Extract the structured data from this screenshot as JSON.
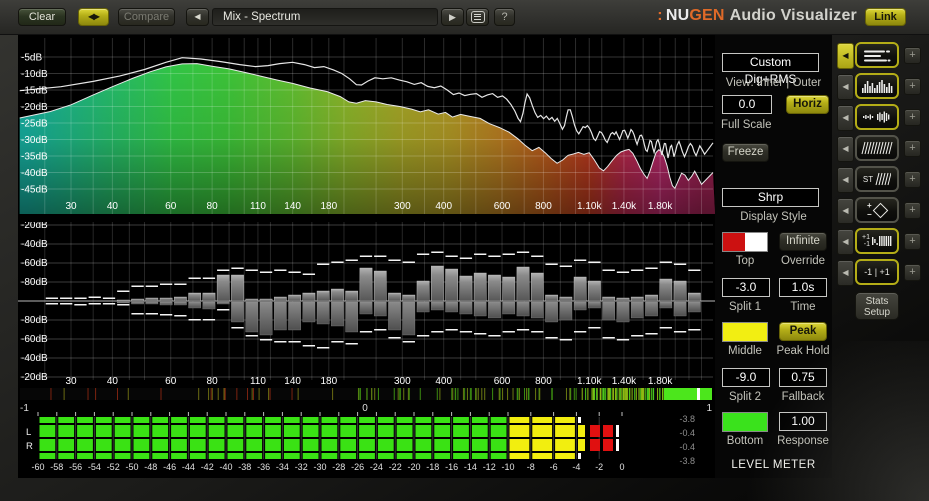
{
  "logo": {
    "dots": ":",
    "nu": "NU",
    "gen": "GEN",
    "rest": "Audio Visualizer",
    "accent": "#e06a28"
  },
  "toolbar": {
    "clear": "Clear",
    "ab_icon": "◀▶",
    "compare": "Compare",
    "prev_icon": "◀",
    "preset": "Mix - Spectrum",
    "next_icon": "▶",
    "help": "?",
    "link": "Link"
  },
  "spectrum": {
    "db_labels": [
      "-5dB",
      "-10dB",
      "-15dB",
      "-20dB",
      "-25dB",
      "-30dB",
      "-35dB",
      "-40dB",
      "-45dB"
    ],
    "db_values": [
      -5,
      -10,
      -15,
      -20,
      -25,
      -30,
      -35,
      -40,
      -45
    ],
    "freq_labels": [
      [
        30,
        "30"
      ],
      [
        40,
        "40"
      ],
      [
        60,
        "60"
      ],
      [
        80,
        "80"
      ],
      [
        110,
        "110"
      ],
      [
        140,
        "140"
      ],
      [
        180,
        "180"
      ],
      [
        300,
        "300"
      ],
      [
        400,
        "400"
      ],
      [
        600,
        "600"
      ],
      [
        800,
        "800"
      ],
      [
        1100,
        "1.10k"
      ],
      [
        1400,
        "1.40k"
      ],
      [
        1800,
        "1.80k"
      ]
    ],
    "grid_freqs": [
      25,
      30,
      35,
      40,
      45,
      50,
      60,
      70,
      80,
      90,
      100,
      110,
      120,
      140,
      160,
      180,
      200,
      250,
      300,
      350,
      400,
      450,
      500,
      600,
      700,
      800,
      900,
      1000,
      1100,
      1200,
      1400,
      1600,
      1800,
      2000,
      2200,
      2400
    ],
    "gradient_stops": [
      [
        22,
        "#17b2a2"
      ],
      [
        40,
        "#27c06b"
      ],
      [
        60,
        "#33cb49"
      ],
      [
        90,
        "#3fc93a"
      ],
      [
        140,
        "#63c231"
      ],
      [
        200,
        "#8cb92b"
      ],
      [
        300,
        "#a9a827"
      ],
      [
        420,
        "#b49b25"
      ],
      [
        600,
        "#bd7f22"
      ],
      [
        800,
        "#c1611d"
      ],
      [
        1100,
        "#c23b20"
      ],
      [
        1400,
        "#c02a50"
      ],
      [
        1800,
        "#bf2a6e"
      ],
      [
        2400,
        "#a82458"
      ]
    ],
    "fill_points": [
      [
        21,
        -23.5
      ],
      [
        26,
        -21.5
      ],
      [
        30,
        -19.5
      ],
      [
        35,
        -16.5
      ],
      [
        40,
        -14
      ],
      [
        46,
        -11.5
      ],
      [
        52,
        -9.5
      ],
      [
        58,
        -8
      ],
      [
        65,
        -7.1
      ],
      [
        72,
        -7
      ],
      [
        80,
        -7.8
      ],
      [
        90,
        -8.6
      ],
      [
        100,
        -9.6
      ],
      [
        112,
        -10.8
      ],
      [
        126,
        -12
      ],
      [
        140,
        -13
      ],
      [
        158,
        -14.4
      ],
      [
        178,
        -15.5
      ],
      [
        195,
        -17
      ],
      [
        207,
        -18.6
      ],
      [
        218,
        -19
      ],
      [
        232,
        -18.2
      ],
      [
        250,
        -18.6
      ],
      [
        270,
        -19.4
      ],
      [
        295,
        -20
      ],
      [
        320,
        -20.8
      ],
      [
        340,
        -21.6
      ],
      [
        360,
        -21
      ],
      [
        385,
        -22.3
      ],
      [
        405,
        -21.8
      ],
      [
        425,
        -23.2
      ],
      [
        450,
        -22.4
      ],
      [
        480,
        -23
      ],
      [
        515,
        -23.6
      ],
      [
        550,
        -25.2
      ],
      [
        590,
        -26.4
      ],
      [
        630,
        -27.8
      ],
      [
        670,
        -29.8
      ],
      [
        705,
        -31.8
      ],
      [
        740,
        -33.4
      ],
      [
        775,
        -32.4
      ],
      [
        810,
        -34
      ],
      [
        845,
        -35.8
      ],
      [
        880,
        -37.2
      ],
      [
        915,
        -36.2
      ],
      [
        950,
        -34.8
      ],
      [
        985,
        -34.4
      ],
      [
        1020,
        -33.9
      ],
      [
        1060,
        -34.5
      ],
      [
        1100,
        -34
      ],
      [
        1140,
        -36.2
      ],
      [
        1180,
        -38.6
      ],
      [
        1215,
        -39.5
      ],
      [
        1250,
        -38.2
      ],
      [
        1290,
        -36.4
      ],
      [
        1330,
        -34.8
      ],
      [
        1370,
        -33.8
      ],
      [
        1410,
        -33.3
      ],
      [
        1450,
        -33
      ],
      [
        1490,
        -34.2
      ],
      [
        1530,
        -36.4
      ],
      [
        1570,
        -38.8
      ],
      [
        1610,
        -40.6
      ],
      [
        1645,
        -41.8
      ],
      [
        1680,
        -39.4
      ],
      [
        1715,
        -36.6
      ],
      [
        1750,
        -34
      ],
      [
        1785,
        -33.1
      ],
      [
        1820,
        -33.8
      ],
      [
        1855,
        -35.4
      ],
      [
        1890,
        -38
      ],
      [
        1925,
        -41.4
      ],
      [
        1960,
        -44
      ],
      [
        1995,
        -44.8
      ],
      [
        2040,
        -42.6
      ],
      [
        2090,
        -40.2
      ],
      [
        2140,
        -40.8
      ],
      [
        2190,
        -42.4
      ],
      [
        2240,
        -41.2
      ],
      [
        2290,
        -39.6
      ],
      [
        2340,
        -41.4
      ],
      [
        2400,
        -43.6
      ],
      [
        2600,
        -40
      ]
    ],
    "outer_points": [
      [
        21,
        -15.2
      ],
      [
        28,
        -14
      ],
      [
        35,
        -12.4
      ],
      [
        42,
        -10.8
      ],
      [
        50,
        -8.8
      ],
      [
        58,
        -6.6
      ],
      [
        65,
        -5.2
      ],
      [
        74,
        -5.6
      ],
      [
        85,
        -6.4
      ],
      [
        97,
        -7.3
      ],
      [
        108,
        -7.9
      ],
      [
        118,
        -7.6
      ],
      [
        128,
        -7
      ],
      [
        140,
        -6.6
      ],
      [
        152,
        -7.3
      ],
      [
        163,
        -8.2
      ],
      [
        174,
        -7.9
      ],
      [
        186,
        -8.9
      ],
      [
        197,
        -10
      ],
      [
        208,
        -11.6
      ],
      [
        218,
        -13.4
      ],
      [
        226,
        -13.5
      ],
      [
        236,
        -12.3
      ],
      [
        248,
        -11.3
      ],
      [
        262,
        -11.6
      ],
      [
        278,
        -11.3
      ],
      [
        294,
        -12
      ],
      [
        310,
        -12.5
      ],
      [
        326,
        -13.3
      ],
      [
        342,
        -12.8
      ],
      [
        358,
        -13.9
      ],
      [
        375,
        -14.3
      ],
      [
        392,
        -13.8
      ],
      [
        410,
        -15
      ],
      [
        428,
        -16.4
      ],
      [
        445,
        -15.9
      ],
      [
        463,
        -16.7
      ],
      [
        482,
        -16.3
      ],
      [
        502,
        -16.1
      ],
      [
        522,
        -17.2
      ],
      [
        542,
        -16.5
      ],
      [
        562,
        -16.1
      ],
      [
        582,
        -17.2
      ],
      [
        602,
        -16.8
      ],
      [
        620,
        -17.8
      ],
      [
        638,
        -19.4
      ],
      [
        656,
        -21.4
      ],
      [
        671,
        -23.6
      ],
      [
        682,
        -24.6
      ],
      [
        694,
        -22
      ],
      [
        704,
        -18.8
      ],
      [
        714,
        -16.2
      ],
      [
        727,
        -17.4
      ],
      [
        741,
        -19.8
      ],
      [
        755,
        -21.9
      ],
      [
        769,
        -23.3
      ],
      [
        785,
        -22.7
      ],
      [
        801,
        -23.7
      ],
      [
        817,
        -22.9
      ],
      [
        833,
        -24
      ],
      [
        849,
        -23.3
      ],
      [
        865,
        -24.5
      ],
      [
        881,
        -23.6
      ],
      [
        897,
        -25.2
      ],
      [
        913,
        -26.9
      ],
      [
        926,
        -25.8
      ],
      [
        938,
        -23.2
      ],
      [
        950,
        -21
      ],
      [
        964,
        -21
      ],
      [
        978,
        -23
      ],
      [
        993,
        -25.6
      ],
      [
        1008,
        -27.4
      ],
      [
        1023,
        -28.3
      ],
      [
        1038,
        -27.2
      ],
      [
        1054,
        -26.1
      ],
      [
        1070,
        -26.4
      ],
      [
        1086,
        -25.8
      ],
      [
        1102,
        -26.6
      ],
      [
        1118,
        -28
      ],
      [
        1134,
        -29.7
      ],
      [
        1150,
        -30.3
      ],
      [
        1166,
        -29
      ],
      [
        1182,
        -27.6
      ],
      [
        1198,
        -27.9
      ],
      [
        1214,
        -28.9
      ],
      [
        1230,
        -30.2
      ],
      [
        1246,
        -30.9
      ],
      [
        1262,
        -29.6
      ],
      [
        1278,
        -28.3
      ],
      [
        1294,
        -27.9
      ],
      [
        1310,
        -28.5
      ],
      [
        1326,
        -27.7
      ],
      [
        1342,
        -28.9
      ],
      [
        1358,
        -30
      ],
      [
        1374,
        -28.7
      ],
      [
        1390,
        -27.3
      ],
      [
        1406,
        -27.2
      ],
      [
        1422,
        -28.3
      ],
      [
        1438,
        -29.6
      ],
      [
        1454,
        -28.4
      ],
      [
        1470,
        -27
      ],
      [
        1486,
        -27.5
      ],
      [
        1502,
        -28.6
      ],
      [
        1518,
        -30.2
      ],
      [
        1534,
        -31.5
      ],
      [
        1550,
        -30
      ],
      [
        1566,
        -28.8
      ],
      [
        1582,
        -28.7
      ],
      [
        1598,
        -29.8
      ],
      [
        1614,
        -31.6
      ],
      [
        1630,
        -33.2
      ],
      [
        1646,
        -33.6
      ],
      [
        1662,
        -32
      ],
      [
        1678,
        -30.3
      ],
      [
        1694,
        -30.6
      ],
      [
        1710,
        -32.4
      ],
      [
        1726,
        -33.9
      ],
      [
        1742,
        -32.3
      ],
      [
        1758,
        -30.6
      ],
      [
        1774,
        -30.1
      ],
      [
        1790,
        -31.2
      ],
      [
        1806,
        -33
      ],
      [
        1822,
        -34.7
      ],
      [
        1838,
        -32.9
      ],
      [
        1854,
        -31.2
      ],
      [
        1870,
        -31.3
      ],
      [
        1886,
        -33.3
      ],
      [
        1902,
        -35.6
      ],
      [
        1918,
        -34
      ],
      [
        1934,
        -32.2
      ],
      [
        1950,
        -31.8
      ],
      [
        1966,
        -33.4
      ],
      [
        1982,
        -35.2
      ],
      [
        2002,
        -33.8
      ],
      [
        2026,
        -31.7
      ],
      [
        2052,
        -30.6
      ],
      [
        2076,
        -31.9
      ],
      [
        2102,
        -33.7
      ],
      [
        2132,
        -35.2
      ],
      [
        2162,
        -33.8
      ],
      [
        2192,
        -32.1
      ],
      [
        2222,
        -31.2
      ],
      [
        2252,
        -32
      ],
      [
        2282,
        -33.8
      ],
      [
        2312,
        -34.9
      ],
      [
        2342,
        -33.4
      ],
      [
        2372,
        -31.9
      ],
      [
        2402,
        -32.8
      ],
      [
        2452,
        -34.5
      ],
      [
        2600,
        -31
      ]
    ]
  },
  "bars_display": {
    "db_labels": [
      "-20dB",
      "-40dB",
      "-60dB",
      "-80dB"
    ],
    "fmin": 25,
    "fmax": 2400,
    "bands": 46,
    "bars": [
      [
        0,
        0,
        2,
        2
      ],
      [
        0,
        0,
        2,
        2
      ],
      [
        0,
        0,
        2,
        3
      ],
      [
        0,
        0,
        3,
        2
      ],
      [
        0,
        0,
        2,
        2
      ],
      [
        1,
        1,
        9,
        3
      ],
      [
        2,
        2,
        14,
        12
      ],
      [
        3,
        2,
        14,
        12
      ],
      [
        3,
        3,
        16,
        13
      ],
      [
        4,
        3,
        16,
        14
      ],
      [
        8,
        6,
        22,
        18
      ],
      [
        8,
        7,
        22,
        18
      ],
      [
        26,
        2,
        30,
        8
      ],
      [
        26,
        20,
        32,
        26
      ],
      [
        2,
        30,
        30,
        34
      ],
      [
        2,
        33,
        28,
        38
      ],
      [
        4,
        28,
        30,
        40
      ],
      [
        6,
        28,
        28,
        40
      ],
      [
        8,
        20,
        26,
        44
      ],
      [
        10,
        22,
        36,
        46
      ],
      [
        12,
        24,
        38,
        40
      ],
      [
        10,
        30,
        40,
        42
      ],
      [
        33,
        12,
        44,
        30
      ],
      [
        30,
        14,
        44,
        28
      ],
      [
        8,
        28,
        40,
        36
      ],
      [
        6,
        33,
        38,
        40
      ],
      [
        20,
        10,
        46,
        34
      ],
      [
        35,
        8,
        48,
        30
      ],
      [
        32,
        10,
        44,
        28
      ],
      [
        25,
        12,
        42,
        30
      ],
      [
        28,
        14,
        46,
        32
      ],
      [
        26,
        16,
        44,
        34
      ],
      [
        24,
        12,
        46,
        30
      ],
      [
        34,
        14,
        48,
        28
      ],
      [
        28,
        16,
        44,
        30
      ],
      [
        6,
        20,
        36,
        36
      ],
      [
        4,
        18,
        34,
        38
      ],
      [
        24,
        8,
        40,
        30
      ],
      [
        20,
        6,
        38,
        26
      ],
      [
        4,
        18,
        30,
        36
      ],
      [
        3,
        20,
        28,
        38
      ],
      [
        4,
        16,
        30,
        34
      ],
      [
        6,
        14,
        32,
        32
      ],
      [
        22,
        6,
        38,
        26
      ],
      [
        20,
        14,
        36,
        30
      ],
      [
        8,
        10,
        30,
        28
      ]
    ]
  },
  "correlation": {
    "labels": [
      "-1",
      "0",
      "1"
    ],
    "seed": 77,
    "segments": [
      {
        "a": 30,
        "b": 330,
        "n": 26,
        "colors": [
          "#6a6a12",
          "#7c2310"
        ]
      },
      {
        "a": 330,
        "b": 560,
        "n": 62,
        "colors": [
          "#6a7a12",
          "#3b8c10"
        ]
      },
      {
        "a": 560,
        "b": 646,
        "n": 72,
        "colors": [
          "#48c81c",
          "#8fbb12"
        ]
      }
    ],
    "solid": [
      {
        "a": 646,
        "b": 679,
        "color": "#4ce61c"
      },
      {
        "a": 682,
        "b": 694,
        "color": "#4ce61c"
      }
    ],
    "notch": {
      "a": 679,
      "b": 682,
      "color": "#ffffff"
    }
  },
  "meter": {
    "channel_labels": [
      "L",
      "R"
    ],
    "scale_values": [
      -60,
      -58,
      -56,
      -54,
      -52,
      -50,
      -48,
      -46,
      -44,
      -42,
      -40,
      -38,
      -36,
      -34,
      -32,
      -30,
      -28,
      -26,
      -24,
      -22,
      -20,
      -18,
      -16,
      -14,
      -12,
      -10,
      -8,
      -6,
      -4,
      -2,
      0
    ],
    "readouts": [
      "-3.8",
      "-0.4",
      "-0.4",
      "-3.8"
    ],
    "colors": {
      "green": "#3ae214",
      "yellow": "#f2ee0f",
      "red": "#e01010"
    }
  },
  "controls": {
    "view_mode": "Custom Dig+RMS",
    "view_sub": "View: Inner | Outer",
    "full_scale_value": "0.0",
    "horiz": "Horiz",
    "full_scale_label": "Full Scale",
    "freeze": "Freeze",
    "display_style_value": "Shrp",
    "display_style_label": "Display Style",
    "top_label": "Top",
    "infinite": "Infinite",
    "override_label": "Override",
    "split1_value": "-3.0",
    "split1_label": "Split 1",
    "time_value": "1.0s",
    "time_label": "Time",
    "middle_label": "Middle",
    "peak": "Peak",
    "peak_hold_label": "Peak Hold",
    "split2_value": "-9.0",
    "split2_label": "Split 2",
    "fallback_value": "0.75",
    "fallback_label": "Fallback",
    "bottom_label": "Bottom",
    "response_value": "1.00",
    "response_label": "Response",
    "level_meter": "LEVEL METER",
    "swatch_colors": {
      "top_left": "#cc1111",
      "top_right": "#ffffff",
      "middle": "#f2ee12",
      "bottom": "#3ae21c"
    }
  },
  "side": {
    "arrow_icon": "◀",
    "plus_icon": "+",
    "st": "ST",
    "plus1": "+1",
    "minus1": "-1",
    "corr_btn": "-1  |  +1",
    "stats_line1": "Stats",
    "stats_line2": "Setup"
  }
}
